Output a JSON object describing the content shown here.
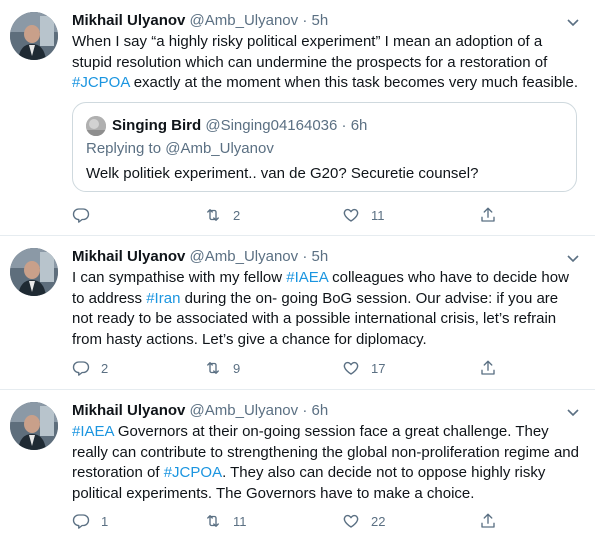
{
  "colors": {
    "link": "#1b95e0",
    "secondary": "#5b7083",
    "border": "#e6ecf0"
  },
  "tweets": [
    {
      "name": "Mikhail Ulyanov",
      "handle": "@Amb_Ulyanov",
      "dot": "·",
      "time": "5h",
      "text": [
        {
          "t": "When I say “a highly risky political experiment” I mean an adoption of a stupid resolution which can undermine the prospects for a restoration of "
        },
        {
          "t": "#JCPOA",
          "tag": true
        },
        {
          "t": " exactly at the moment when this task becomes very much feasible."
        }
      ],
      "quote": {
        "name": "Singing Bird",
        "handle": "@Singing04164036",
        "dot": "·",
        "time": "6h",
        "reply_line": "Replying to @Amb_Ulyanov",
        "text": "Welk politiek experiment.. van de G20? Securetie counsel?"
      },
      "replies": "",
      "retweets": "2",
      "likes": "11"
    },
    {
      "name": "Mikhail Ulyanov",
      "handle": "@Amb_Ulyanov",
      "dot": "·",
      "time": "5h",
      "text": [
        {
          "t": "I can sympathise with my fellow "
        },
        {
          "t": "#IAEA",
          "tag": true
        },
        {
          "t": " colleagues who have to decide how to address "
        },
        {
          "t": "#Iran",
          "tag": true
        },
        {
          "t": " during the on- going BoG session. Our advise: if you are not ready to be associated with a possible international crisis, let’s refrain from  hasty actions. Let’s give a chance for diplomacy."
        }
      ],
      "replies": "2",
      "retweets": "9",
      "likes": "17"
    },
    {
      "name": "Mikhail Ulyanov",
      "handle": "@Amb_Ulyanov",
      "dot": "·",
      "time": "6h",
      "text": [
        {
          "t": "#IAEA",
          "tag": true
        },
        {
          "t": " Governors at their on-going session face a great challenge. They really can contribute to strengthening the global non-proliferation regime and restoration of "
        },
        {
          "t": "#JCPOA",
          "tag": true
        },
        {
          "t": ". They also can decide not to oppose highly risky political experiments. The Governors have to make a choice."
        }
      ],
      "replies": "1",
      "retweets": "11",
      "likes": "22"
    }
  ]
}
